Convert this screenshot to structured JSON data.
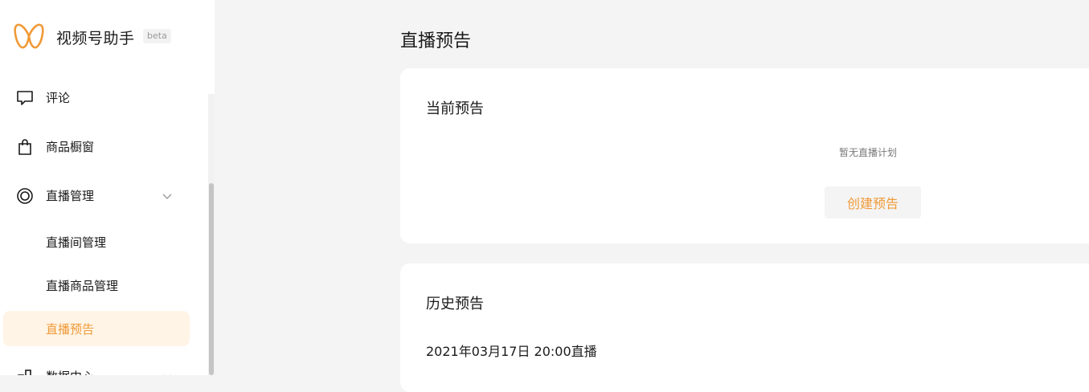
{
  "brand": {
    "name": "视频号助手",
    "badge": "beta",
    "accent_color": "#f09a37"
  },
  "sidebar": {
    "items": [
      {
        "label": "评论",
        "icon": "comment-icon"
      },
      {
        "label": "商品橱窗",
        "icon": "shopping-bag-icon"
      },
      {
        "label": "直播管理",
        "icon": "live-circle-icon",
        "expanded": true
      },
      {
        "label": "数据中心",
        "icon": "data-chart-icon"
      }
    ],
    "live_sub_items": [
      {
        "label": "直播间管理",
        "active": false
      },
      {
        "label": "直播商品管理",
        "active": false
      },
      {
        "label": "直播预告",
        "active": true
      }
    ]
  },
  "main": {
    "title": "直播预告",
    "current": {
      "title": "当前预告",
      "empty_text": "暂无直播计划",
      "create_button": "创建预告"
    },
    "history": {
      "title": "历史预告",
      "items": [
        "2021年03月17日 20:00直播"
      ]
    }
  }
}
